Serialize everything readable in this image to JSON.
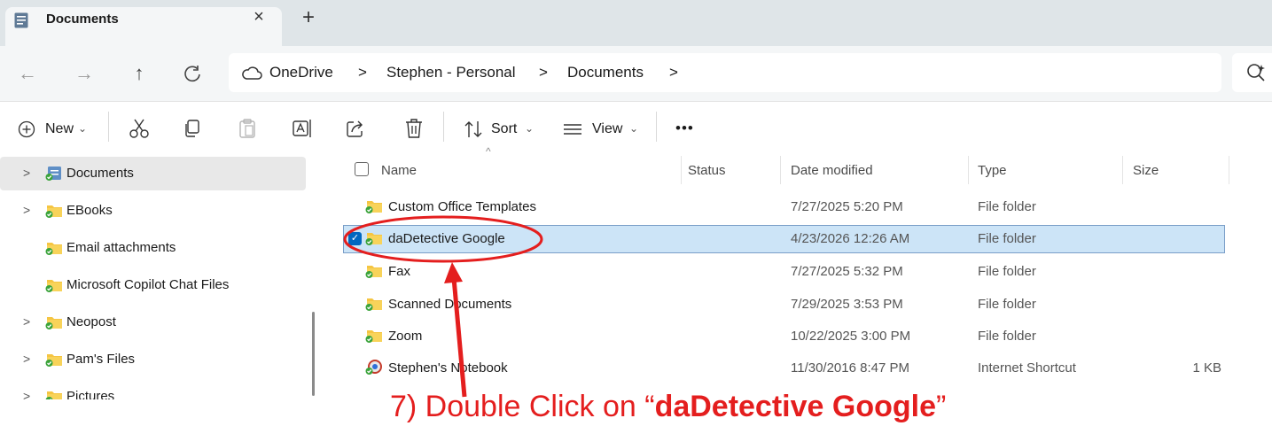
{
  "tab": {
    "title": "Documents",
    "close": "×",
    "new_tab": "+"
  },
  "nav": {
    "back": "←",
    "forward": "→",
    "up": "↑",
    "refresh": "C",
    "breadcrumb": [
      "OneDrive",
      "Stephen - Personal",
      "Documents"
    ],
    "separator": ">"
  },
  "toolbar": {
    "new_label": "New",
    "sort_label": "Sort",
    "view_label": "View",
    "more_label": "•••",
    "dropdown": "⌄"
  },
  "sidebar": {
    "items": [
      {
        "label": "Documents",
        "expandable": true,
        "selected": true
      },
      {
        "label": "EBooks",
        "expandable": true
      },
      {
        "label": "Email attachments",
        "expandable": false
      },
      {
        "label": "Microsoft Copilot Chat Files",
        "expandable": false
      },
      {
        "label": "Neopost",
        "expandable": true
      },
      {
        "label": "Pam's Files",
        "expandable": true
      },
      {
        "label": "Pictures",
        "expandable": true
      }
    ]
  },
  "columns": {
    "name": "Name",
    "status": "Status",
    "date": "Date modified",
    "type": "Type",
    "size": "Size"
  },
  "files": [
    {
      "name": "Custom Office Templates",
      "date": "7/27/2025 5:20 PM",
      "type": "File folder",
      "size": "",
      "icon": "folder"
    },
    {
      "name": "daDetective Google",
      "date": "4/23/2026 12:26 AM",
      "type": "File folder",
      "size": "",
      "icon": "folder",
      "selected": true
    },
    {
      "name": "Fax",
      "date": "7/27/2025 5:32 PM",
      "type": "File folder",
      "size": "",
      "icon": "folder"
    },
    {
      "name": "Scanned Documents",
      "date": "7/29/2025 3:53 PM",
      "type": "File folder",
      "size": "",
      "icon": "folder"
    },
    {
      "name": "Zoom",
      "date": "10/22/2025 3:00 PM",
      "type": "File folder",
      "size": "",
      "icon": "folder"
    },
    {
      "name": "Stephen's Notebook",
      "date": "11/30/2016 8:47 PM",
      "type": "Internet Shortcut",
      "size": "1 KB",
      "icon": "shortcut"
    }
  ],
  "caption": {
    "prefix": "7)  Double Click on “",
    "bold": "daDetective Google",
    "suffix": "”"
  },
  "colors": {
    "accent": "#0067c0",
    "selection": "#cce4f7",
    "annotation": "#e41e1e",
    "folder": "#f5c542",
    "sync_ok": "#3ba33b"
  }
}
